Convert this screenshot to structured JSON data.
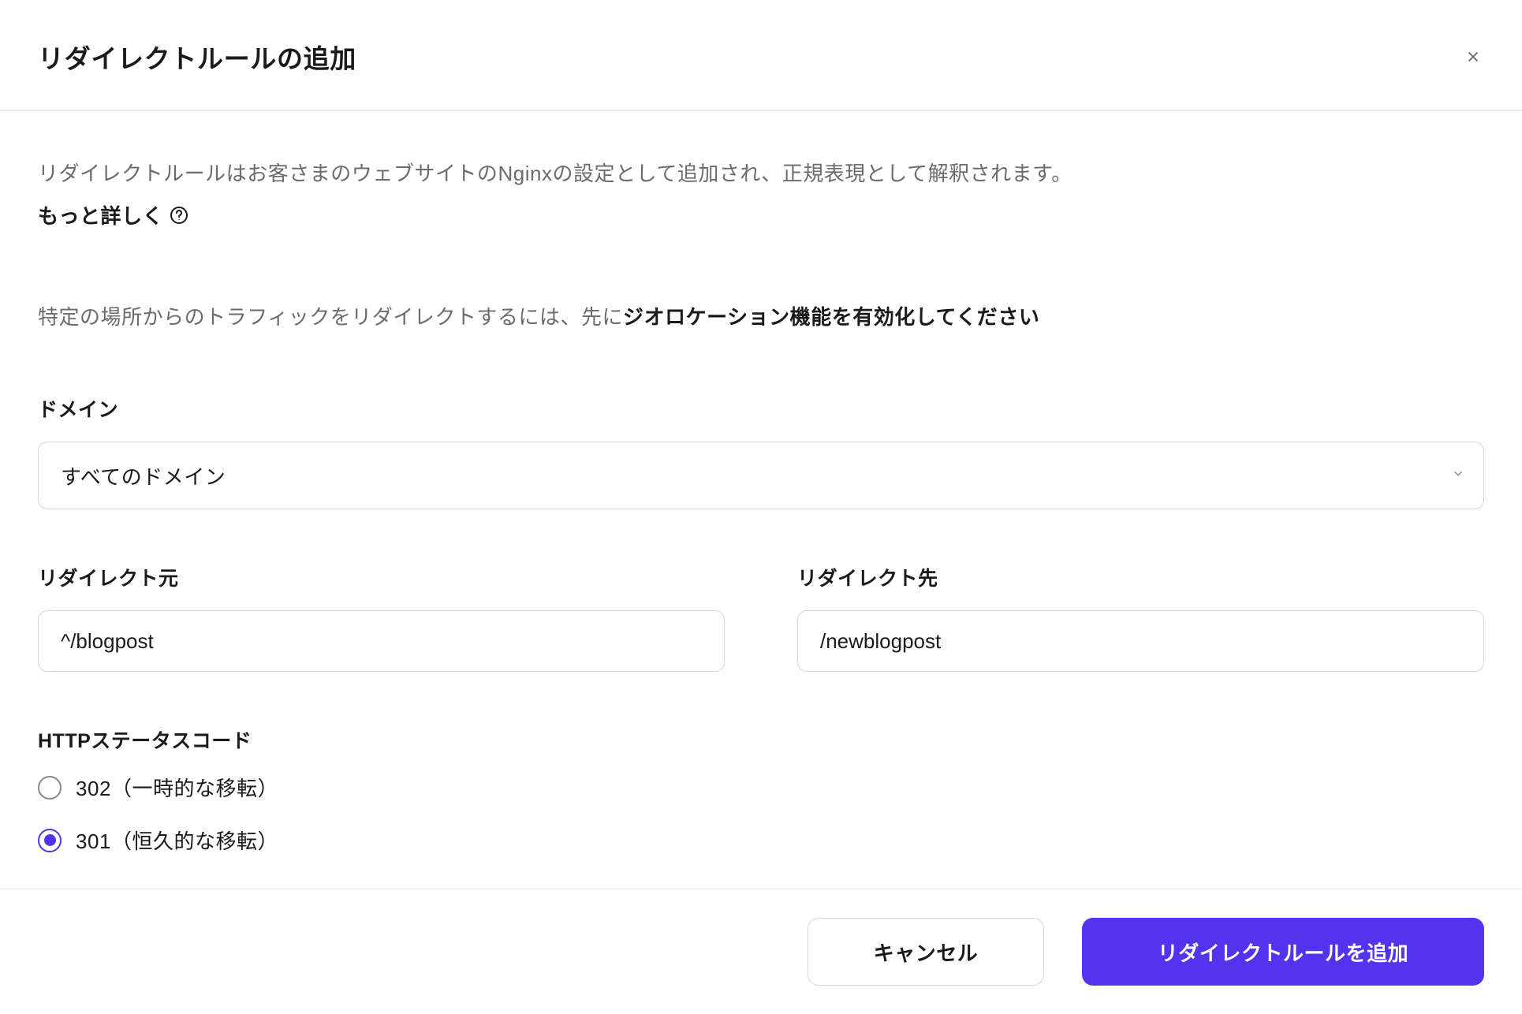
{
  "header": {
    "title": "リダイレクトルールの追加"
  },
  "description": {
    "text": "リダイレクトルールはお客さまのウェブサイトのNginxの設定として追加され、正規表現として解釈されます。",
    "learn_more": "もっと詳しく"
  },
  "geo_note": {
    "prefix": "特定の場所からのトラフィックをリダイレクトするには、先に",
    "strong": "ジオロケーション機能を有効化してください"
  },
  "form": {
    "domain": {
      "label": "ドメイン",
      "value": "すべてのドメイン"
    },
    "redirect_from": {
      "label": "リダイレクト元",
      "value": "^/blogpost"
    },
    "redirect_to": {
      "label": "リダイレクト先",
      "value": "/newblogpost"
    },
    "status_code": {
      "label": "HTTPステータスコード",
      "options": [
        {
          "label": "302（一時的な移転）",
          "selected": false
        },
        {
          "label": "301（恒久的な移転）",
          "selected": true
        }
      ]
    }
  },
  "footer": {
    "cancel": "キャンセル",
    "submit": "リダイレクトルールを追加"
  }
}
